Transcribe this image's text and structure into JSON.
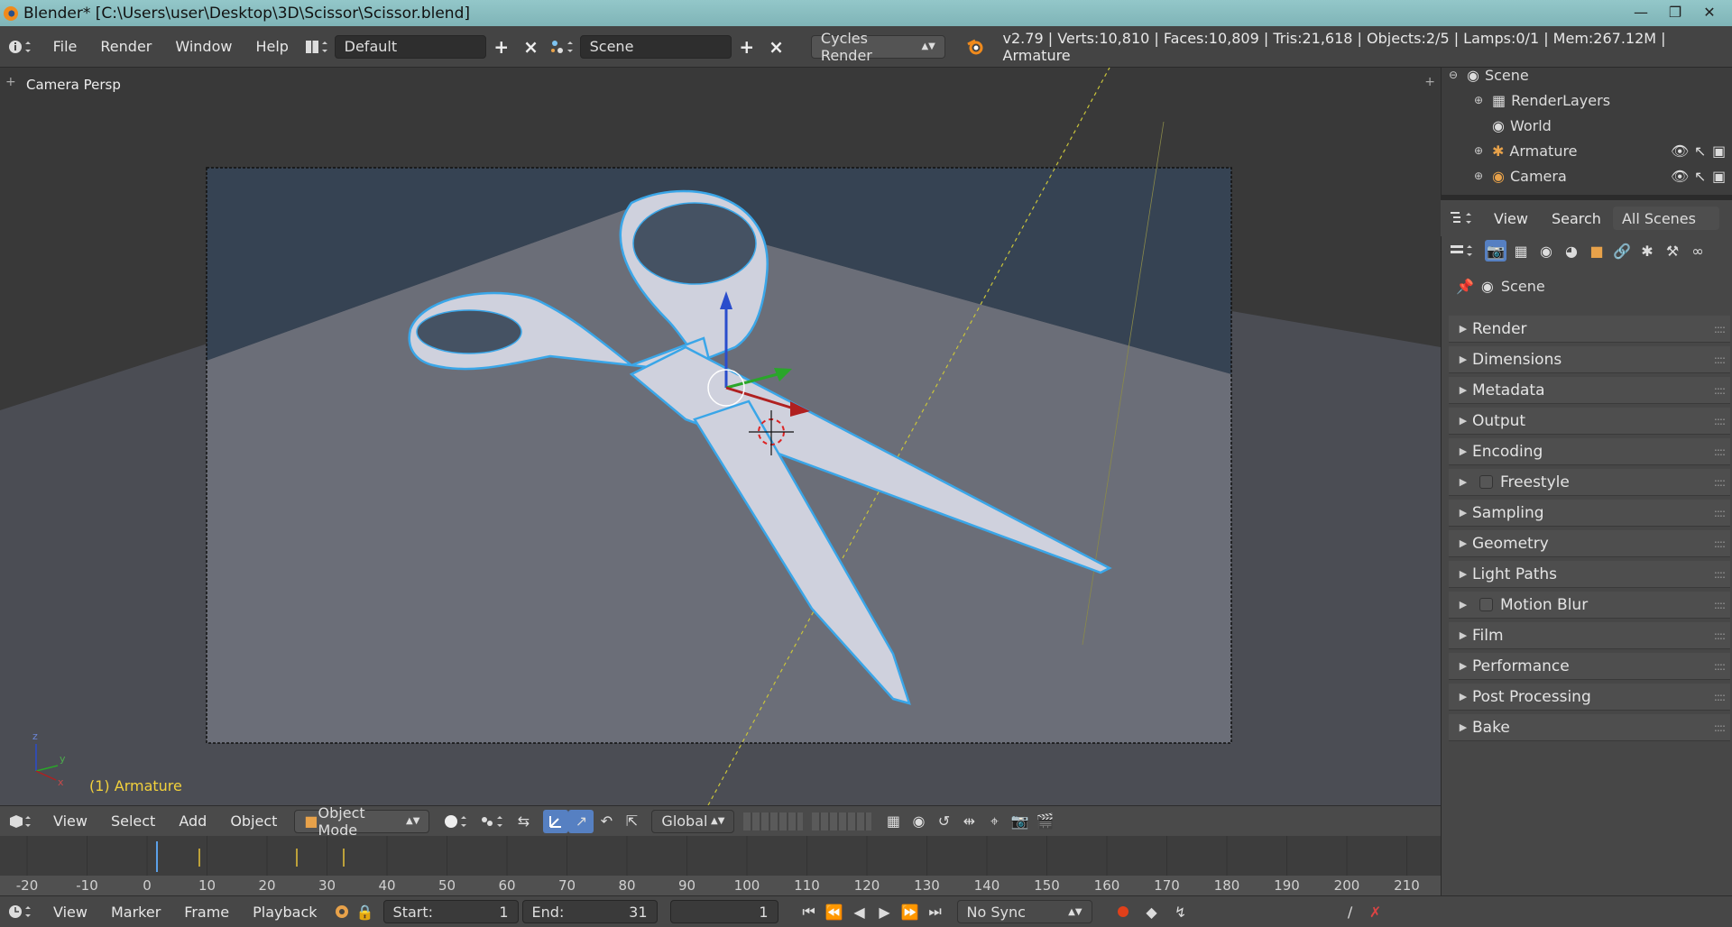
{
  "window": {
    "title": "Blender* [C:\\Users\\user\\Desktop\\3D\\Scissor\\Scissor.blend]"
  },
  "info": {
    "menu": [
      "File",
      "Render",
      "Window",
      "Help"
    ],
    "screen_layout": "Default",
    "scene": "Scene",
    "render_engine": "Cycles Render",
    "stats": "v2.79 | Verts:10,810 | Faces:10,809 | Tris:21,618 | Objects:2/5 | Lamps:0/1 | Mem:267.12M | Armature"
  },
  "viewport": {
    "view_label": "Camera Persp",
    "active_object": "(1) Armature",
    "axis_labels": [
      "z",
      "y",
      "x"
    ]
  },
  "viewport_header": {
    "menu": [
      "View",
      "Select",
      "Add",
      "Object"
    ],
    "mode": "Object Mode",
    "orientation": "Global"
  },
  "timeline": {
    "ticks": [
      "-20",
      "-10",
      "0",
      "10",
      "20",
      "30",
      "40",
      "50",
      "60",
      "70",
      "80",
      "90",
      "100",
      "110",
      "120",
      "130",
      "140",
      "150",
      "160",
      "170",
      "180",
      "190",
      "200",
      "210"
    ],
    "menu": [
      "View",
      "Marker",
      "Frame",
      "Playback"
    ],
    "start_label": "Start:",
    "start_value": "1",
    "end_label": "End:",
    "end_value": "31",
    "current_frame": "1",
    "sync": "No Sync"
  },
  "outliner": {
    "items": [
      {
        "label": "Scene",
        "indent": 0
      },
      {
        "label": "RenderLayers",
        "indent": 1
      },
      {
        "label": "World",
        "indent": 1
      },
      {
        "label": "Armature",
        "indent": 1
      },
      {
        "label": "Camera",
        "indent": 1
      }
    ],
    "header": {
      "view": "View",
      "search": "Search",
      "filter": "All Scenes"
    }
  },
  "properties": {
    "context": "Scene",
    "panels": [
      {
        "label": "Render",
        "checkbox": false
      },
      {
        "label": "Dimensions",
        "checkbox": false
      },
      {
        "label": "Metadata",
        "checkbox": false
      },
      {
        "label": "Output",
        "checkbox": false
      },
      {
        "label": "Encoding",
        "checkbox": false
      },
      {
        "label": "Freestyle",
        "checkbox": true
      },
      {
        "label": "Sampling",
        "checkbox": false
      },
      {
        "label": "Geometry",
        "checkbox": false
      },
      {
        "label": "Light Paths",
        "checkbox": false
      },
      {
        "label": "Motion Blur",
        "checkbox": true
      },
      {
        "label": "Film",
        "checkbox": false
      },
      {
        "label": "Performance",
        "checkbox": false
      },
      {
        "label": "Post Processing",
        "checkbox": false
      },
      {
        "label": "Bake",
        "checkbox": false
      }
    ]
  },
  "colors": {
    "accent_blue": "#5680c2",
    "selection_outline": "#3aa6e8",
    "active_text": "#f2d13c",
    "record": "#e0401a"
  }
}
